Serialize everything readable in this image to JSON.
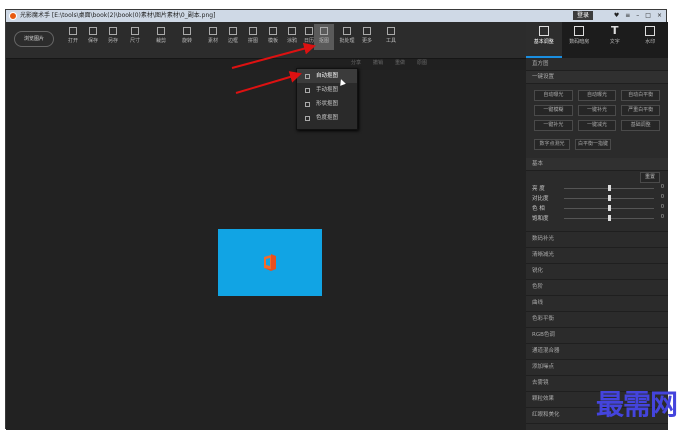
{
  "window": {
    "title": "光影魔术手 [E:\\tools\\桌面\\book(2)\\book(0)素材\\图片素材\\0_副本.png]",
    "login": "登录",
    "controls": [
      "♥",
      "≡",
      "–",
      "□",
      "×"
    ]
  },
  "toolbar": {
    "open_image": "浏览图片",
    "tools": [
      "打开",
      "保存",
      "另存",
      "尺寸",
      "裁剪",
      "旋转",
      "素材",
      "边框",
      "拼图",
      "模板",
      "涂鸦",
      "日历",
      "抠图",
      "批处理",
      "更多",
      "工具"
    ],
    "highlighted_tool": "抠图"
  },
  "subbar": [
    "分享",
    "撤销",
    "重做",
    "原图"
  ],
  "dropdown": {
    "items": [
      "自动抠图",
      "手动抠图",
      "形状抠图",
      "色度抠图"
    ],
    "active": 0
  },
  "canvas_image": {
    "background_color": "#11a4e4",
    "logo": "office-logo"
  },
  "right_tabs": [
    {
      "label": "基本调整",
      "icon": "adjust-icon"
    },
    {
      "label": "数码暗房",
      "icon": "camera-icon"
    },
    {
      "label": "文字",
      "icon": "text-T-icon"
    },
    {
      "label": "水印",
      "icon": "watermark-icon"
    }
  ],
  "right_panel": {
    "histogram": "直方图",
    "one_click": "一键设置",
    "one_click_buttons": [
      "自动曝光",
      "自动曝光",
      "自动白平衡",
      "一键模糊",
      "一键补光",
      "严重白平衡",
      "一键补光",
      "一键减光",
      "基础调整"
    ],
    "one_click_extra": [
      "数字点测光",
      "白平衡一指键"
    ],
    "basic": "基本",
    "reset": "重置",
    "sliders": [
      {
        "label": "亮  度",
        "value": 0.5,
        "display": "0"
      },
      {
        "label": "对比度",
        "value": 0.5,
        "display": "0"
      },
      {
        "label": "色  相",
        "value": 0.5,
        "display": "0"
      },
      {
        "label": "饱和度",
        "value": 0.5,
        "display": "0"
      }
    ],
    "sections": [
      "数码补光",
      "清晰减光",
      "锐化",
      "色阶",
      "曲线",
      "色彩平衡",
      "RGB色调",
      "通道混合器",
      "添加噪点",
      "去雾镜",
      "颗粒效果",
      "红眼和美化"
    ]
  },
  "watermark": "最需网"
}
